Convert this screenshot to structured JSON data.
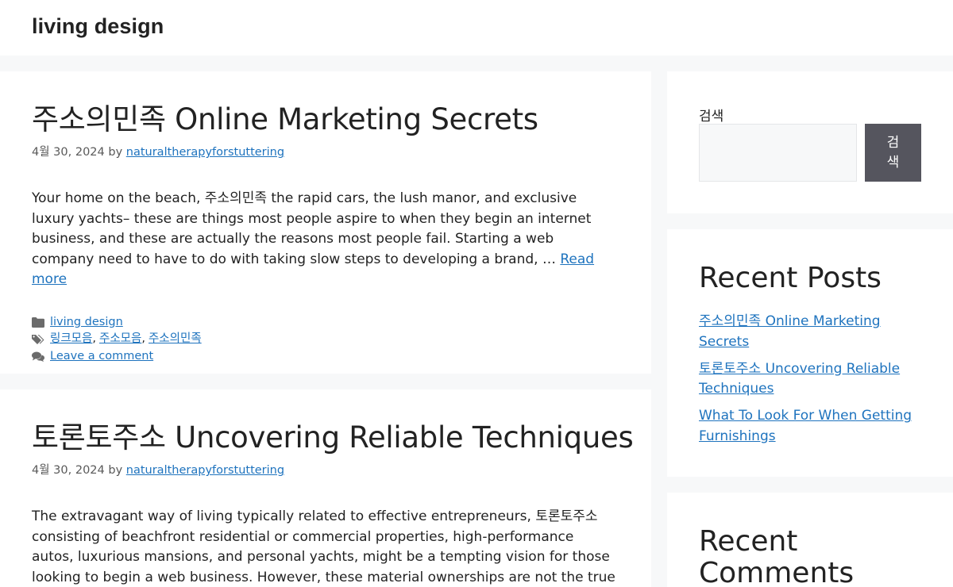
{
  "header": {
    "site_title": "living design"
  },
  "posts": [
    {
      "title": "주소의민족 Online Marketing Secrets",
      "date": "4월 30, 2024",
      "by": "by",
      "author": "naturaltherapyforstuttering",
      "summary": "Your home on the beach, 주소의민족 the rapid cars, the lush manor, and exclusive luxury yachts– these are things most people aspire to when they begin an internet business, and these are actually the reasons most people fail. Starting a web company need to have to do with taking slow steps to developing a brand, …",
      "read_more": "Read more",
      "category": "living design",
      "tags": [
        "링크모음",
        "주소모음",
        "주소의민족"
      ],
      "comments_link": "Leave a comment"
    },
    {
      "title": "토론토주소 Uncovering Reliable Techniques",
      "date": "4월 30, 2024",
      "by": "by",
      "author": "naturaltherapyforstuttering",
      "summary": "The extravagant way of living typically related to effective entrepreneurs, 토론토주소 consisting of beachfront residential or commercial properties, high-performance autos, luxurious mansions, and personal yachts, might be a tempting vision for those looking to begin a web business. However, these material ownerships are not the true pens of"
    }
  ],
  "sidebar": {
    "search": {
      "label": "검색",
      "value": "",
      "button": "검색"
    },
    "recent_posts": {
      "title": "Recent Posts",
      "items": [
        "주소의민족 Online Marketing Secrets",
        "토론토주소 Uncovering Reliable Techniques",
        "What To Look For When Getting Furnishings"
      ]
    },
    "recent_comments": {
      "title": "Recent Comments"
    }
  },
  "icons": {
    "category": "folder-icon",
    "tags": "tags-icon",
    "comments": "comments-icon"
  },
  "colors": {
    "link": "#1e73be",
    "button": "#55555e",
    "background": "#f7f8f9"
  }
}
